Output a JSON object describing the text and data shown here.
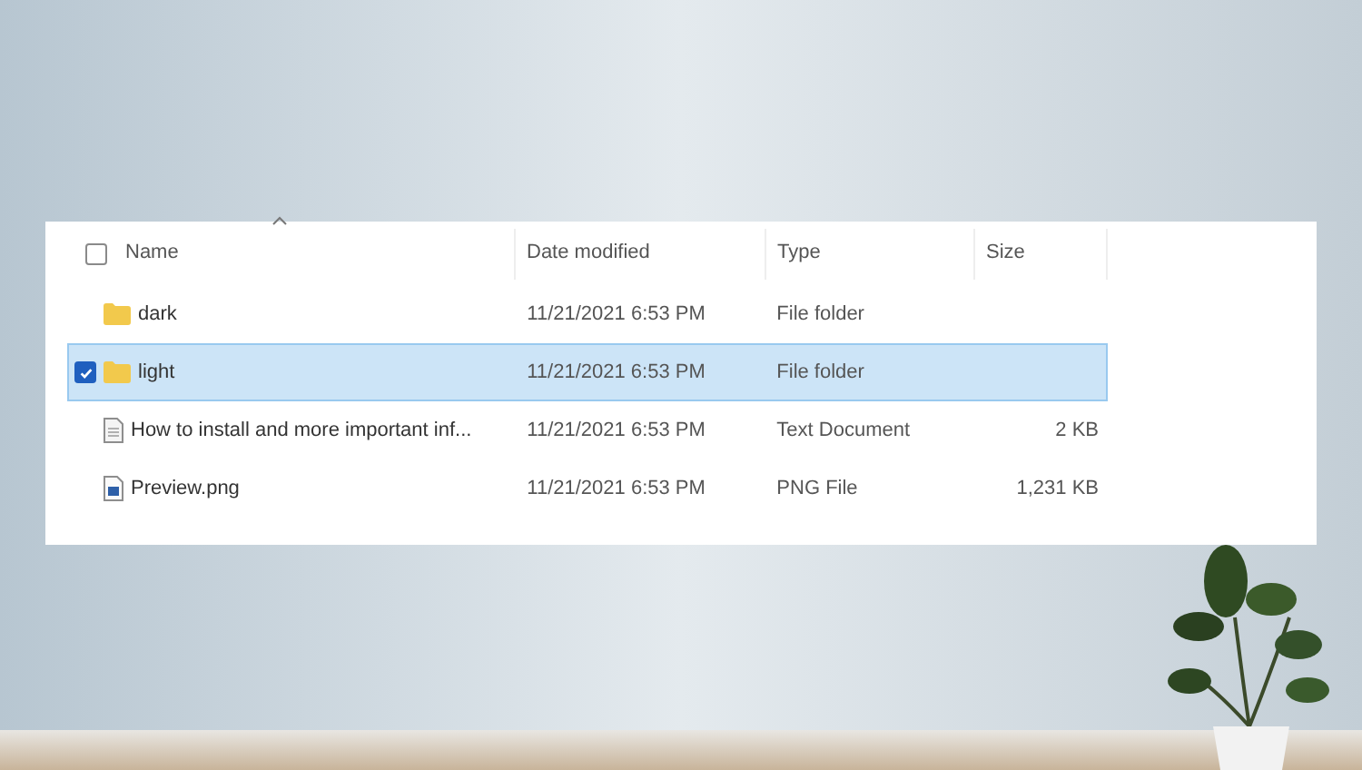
{
  "file_list": {
    "header": {
      "checked": false,
      "columns": [
        "Name",
        "Date modified",
        "Type",
        "Size"
      ]
    },
    "rows": [
      {
        "kind": "folder",
        "name": "dark",
        "date_modified": "11/21/2021 6:53 PM",
        "type": "File folder",
        "selected": false
      },
      {
        "kind": "folder",
        "name": "light",
        "date_modified": "11/21/2021 6:53 PM",
        "type": "File folder",
        "selected": true
      },
      {
        "kind": "text",
        "name": "How to install and more important inf...",
        "date_modified": "11/21/2021 6:53 PM",
        "type": "Text Document",
        "size": "2 KB",
        "selected": false
      },
      {
        "kind": "image",
        "name": "Preview.png",
        "date_modified": "11/21/2021 6:53 PM",
        "type": "PNG File",
        "size": "1,231 KB",
        "selected": false
      }
    ]
  }
}
